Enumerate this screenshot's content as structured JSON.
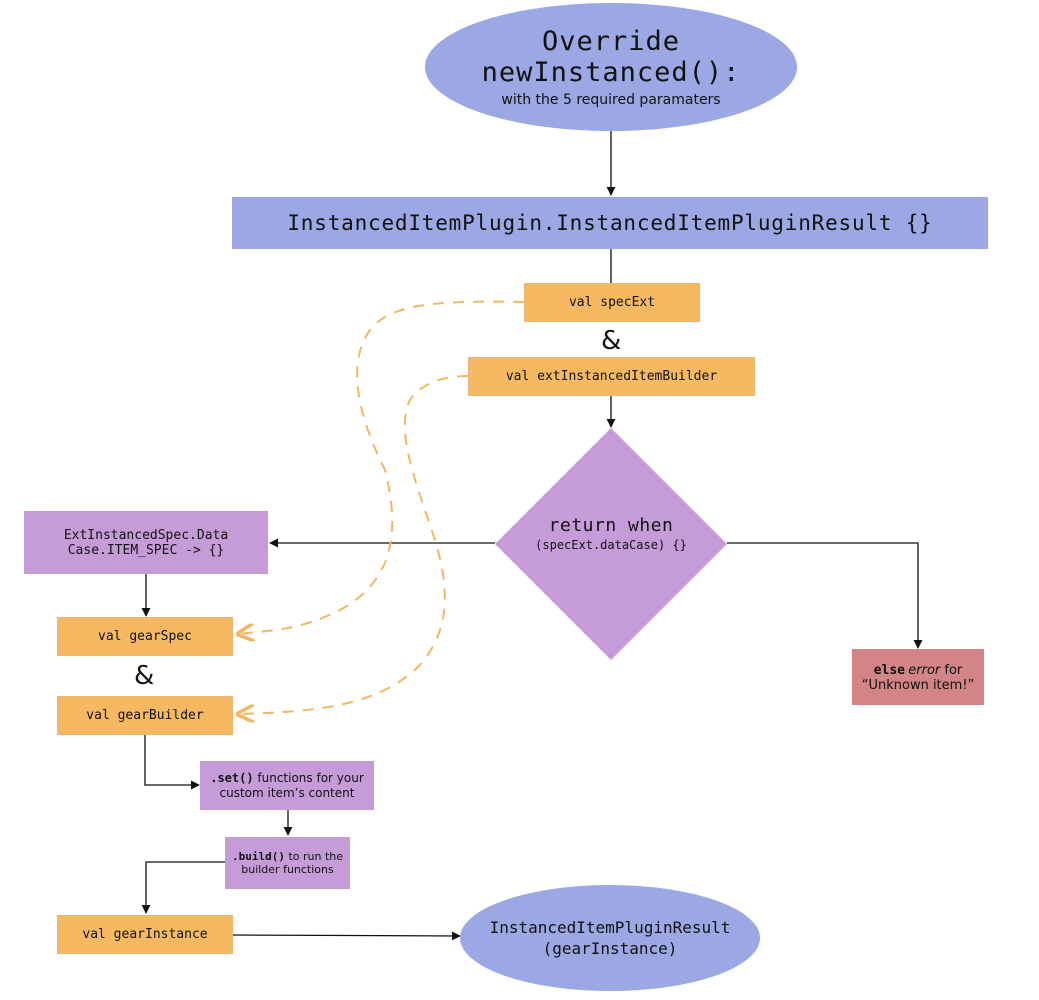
{
  "colors": {
    "terminal_blue": "#9ba8e3",
    "variable_orange": "#f6b962",
    "process_purple": "#c59bd8",
    "error_red": "#d38486",
    "dashed_link": "#f0b866",
    "edge": "#111111"
  },
  "start": {
    "line1": "Override",
    "line2": "newInstanced():",
    "subtitle": "with the 5 required paramaters"
  },
  "result_block": {
    "label": "InstancedItemPlugin.InstancedItemPluginResult {}"
  },
  "spec_ext": {
    "label": "val specExt"
  },
  "amp_top": {
    "label": "&"
  },
  "ext_builder": {
    "label": "val extInstancedItemBuilder"
  },
  "decision": {
    "line1": "return when",
    "line2": "(specExt.dataCase) {}"
  },
  "item_spec_case": {
    "line1": "ExtInstancedSpec.Data",
    "line2": "Case.ITEM_SPEC -> {}"
  },
  "gear_spec": {
    "label": "val gearSpec"
  },
  "amp_bottom": {
    "label": "&"
  },
  "gear_builder": {
    "label": "val gearBuilder"
  },
  "else_error": {
    "code": "else",
    "emphasis": "error",
    "rest": " for",
    "line2": "“Unknown item!”"
  },
  "set_functions": {
    "code": ".set()",
    "rest": " functions for your",
    "line2": "custom item’s content"
  },
  "build_call": {
    "code": ".build()",
    "rest": " to run the",
    "line2": "builder functions"
  },
  "gear_instance": {
    "label": "val gearInstance"
  },
  "end": {
    "line1": "InstancedItemPluginResult",
    "line2": "(gearInstance)"
  }
}
